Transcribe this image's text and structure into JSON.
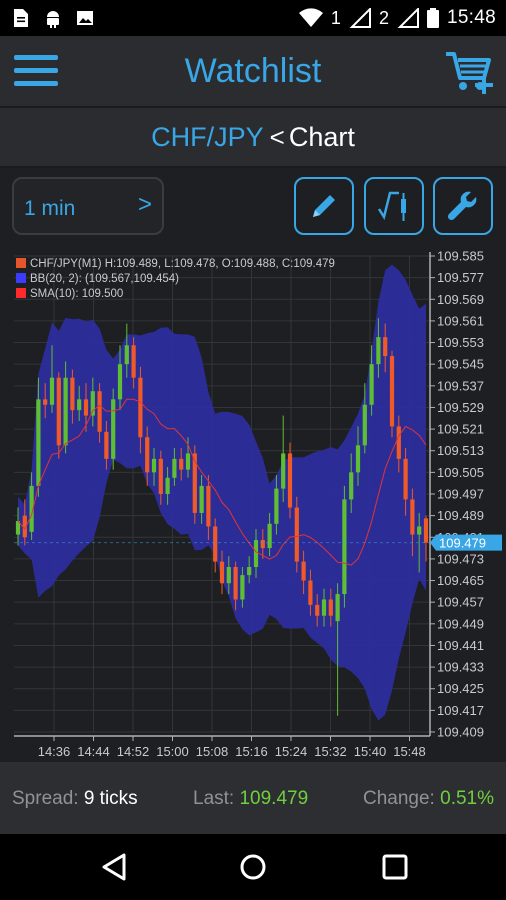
{
  "status_bar": {
    "time": "15:48",
    "sim1_label": "1",
    "sim2_label": "2",
    "icons": [
      "document-icon",
      "android-icon",
      "image-icon",
      "wifi-icon",
      "sim1-signal-icon",
      "sim2-signal-icon",
      "battery-icon"
    ]
  },
  "app_bar": {
    "title": "Watchlist",
    "menu_icon": "hamburger-menu-icon",
    "cart_icon": "add-to-cart-icon"
  },
  "nav": {
    "pair": "CHF/JPY",
    "separator": "<",
    "current": "Chart"
  },
  "toolbar": {
    "timeframe": "1 min",
    "timeframe_arrow": ">",
    "buttons": [
      "pencil-icon",
      "indicator-icon",
      "wrench-icon"
    ],
    "accent_color": "#39a6e6"
  },
  "chart_data": {
    "type": "candlestick",
    "legend": [
      {
        "label": "CHF/JPY(M1) H:109.489, L:109.478, O:109.488, C:109.479",
        "color": "#e6562a"
      },
      {
        "label": "BB(20, 2): (109.567,109.454)",
        "color": "#3c3cff"
      },
      {
        "label": "SMA(10): 109.500",
        "color": "#ff2a2a"
      }
    ],
    "y_ticks": [
      "109.585",
      "109.577",
      "109.569",
      "109.561",
      "109.553",
      "109.545",
      "109.537",
      "109.529",
      "109.521",
      "109.513",
      "109.505",
      "109.497",
      "109.489",
      "109.481",
      "109.473",
      "109.465",
      "109.457",
      "109.449",
      "109.441",
      "109.433",
      "109.425",
      "109.417",
      "109.409"
    ],
    "ylim": [
      109.409,
      109.585
    ],
    "x_ticks": [
      "14:36",
      "14:44",
      "14:52",
      "15:00",
      "15:08",
      "15:16",
      "15:24",
      "15:32",
      "15:40",
      "15:48"
    ],
    "current_price": "109.479",
    "colors": {
      "up": "#5fbf34",
      "down": "#ef5a28",
      "band": "#2d2ea0",
      "sma": "#e0343a",
      "price_tag": "#39a6e6"
    },
    "close": [
      109.487,
      109.481,
      109.5,
      109.532,
      109.53,
      109.54,
      109.515,
      109.54,
      109.528,
      109.532,
      109.526,
      109.535,
      109.52,
      109.51,
      109.532,
      109.545,
      109.552,
      109.54,
      109.518,
      109.505,
      109.51,
      109.497,
      109.503,
      109.51,
      109.506,
      109.512,
      109.49,
      109.5,
      109.485,
      109.472,
      109.464,
      109.47,
      109.458,
      109.467,
      109.47,
      109.48,
      109.477,
      109.486,
      109.499,
      109.512,
      109.492,
      109.472,
      109.465,
      109.456,
      109.452,
      109.458,
      109.452,
      109.46,
      109.495,
      109.505,
      109.515,
      109.53,
      109.545,
      109.555,
      109.548,
      109.522,
      109.51,
      109.495,
      109.482,
      109.485,
      109.479
    ],
    "open": [
      109.482,
      109.489,
      109.483,
      109.5,
      109.532,
      109.53,
      109.54,
      109.515,
      109.54,
      109.528,
      109.532,
      109.526,
      109.535,
      109.52,
      109.51,
      109.532,
      109.545,
      109.552,
      109.54,
      109.518,
      109.505,
      109.51,
      109.497,
      109.503,
      109.51,
      109.506,
      109.512,
      109.49,
      109.5,
      109.485,
      109.472,
      109.464,
      109.47,
      109.458,
      109.467,
      109.47,
      109.48,
      109.477,
      109.486,
      109.499,
      109.512,
      109.492,
      109.472,
      109.465,
      109.456,
      109.452,
      109.458,
      109.45,
      109.46,
      109.495,
      109.505,
      109.515,
      109.53,
      109.545,
      109.555,
      109.548,
      109.522,
      109.51,
      109.495,
      109.482,
      109.488
    ],
    "high": [
      109.492,
      109.495,
      109.505,
      109.54,
      109.538,
      109.552,
      109.542,
      109.546,
      109.543,
      109.537,
      109.538,
      109.54,
      109.538,
      109.524,
      109.536,
      109.552,
      109.56,
      109.555,
      109.544,
      109.522,
      109.514,
      109.513,
      109.507,
      109.514,
      109.514,
      109.518,
      109.515,
      109.504,
      109.504,
      109.488,
      109.476,
      109.474,
      109.472,
      109.47,
      109.474,
      109.484,
      109.484,
      109.49,
      109.504,
      109.526,
      109.516,
      109.496,
      109.476,
      109.469,
      109.46,
      109.462,
      109.462,
      109.464,
      109.5,
      109.512,
      109.522,
      109.538,
      109.552,
      109.562,
      109.56,
      109.55,
      109.526,
      109.514,
      109.499,
      109.49,
      109.489
    ],
    "low": [
      109.478,
      109.478,
      109.48,
      109.496,
      109.525,
      109.527,
      109.51,
      109.512,
      109.523,
      109.524,
      109.52,
      109.522,
      109.516,
      109.506,
      109.506,
      109.528,
      109.54,
      109.536,
      109.512,
      109.5,
      109.5,
      109.493,
      109.493,
      109.5,
      109.502,
      109.503,
      109.486,
      109.486,
      109.48,
      109.468,
      109.46,
      109.46,
      109.454,
      109.455,
      109.464,
      109.466,
      109.473,
      109.474,
      109.482,
      109.494,
      109.488,
      109.468,
      109.46,
      109.452,
      109.448,
      109.448,
      109.448,
      109.415,
      109.455,
      109.49,
      109.5,
      109.512,
      109.526,
      109.54,
      109.542,
      109.518,
      109.505,
      109.489,
      109.474,
      109.468,
      109.472
    ]
  },
  "footer": {
    "spread_label": "Spread:",
    "spread_value": "9 ticks",
    "last_label": "Last:",
    "last_value": "109.479",
    "change_label": "Change:",
    "change_value": "0.51%"
  },
  "android_nav": {
    "buttons": [
      "back-icon",
      "home-icon",
      "recents-icon"
    ]
  }
}
